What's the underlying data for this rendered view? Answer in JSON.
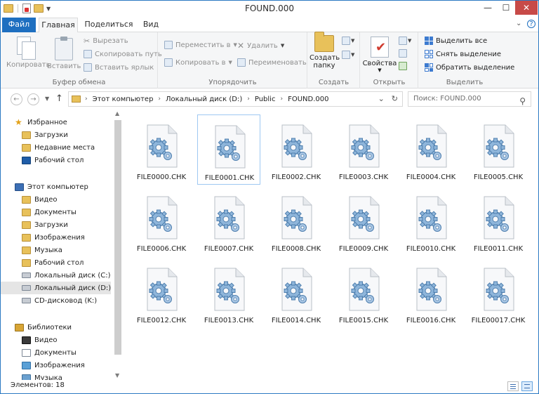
{
  "window": {
    "title": "FOUND.000",
    "controls": {
      "minimize": "—",
      "maximize": "☐",
      "close": "✕"
    }
  },
  "ribbon_tabs": {
    "file": "Файл",
    "home": "Главная",
    "share": "Поделиться",
    "view": "Вид",
    "expand": "⌄",
    "help": "?"
  },
  "ribbon": {
    "clipboard": {
      "label": "Буфер обмена",
      "copy": "Копировать",
      "paste": "Вставить",
      "cut": "Вырезать",
      "copy_path": "Скопировать путь",
      "paste_shortcut": "Вставить ярлык"
    },
    "organize": {
      "label": "Упорядочить",
      "move_to": "Переместить в",
      "copy_to": "Копировать в",
      "delete": "Удалить",
      "rename": "Переименовать"
    },
    "new": {
      "label": "Создать",
      "new_folder_line1": "Создать",
      "new_folder_line2": "папку"
    },
    "open": {
      "label": "Открыть",
      "properties": "Свойства"
    },
    "select": {
      "label": "Выделить",
      "select_all": "Выделить все",
      "select_none": "Снять выделение",
      "invert": "Обратить выделение"
    }
  },
  "address": {
    "crumbs": [
      "Этот компьютер",
      "Локальный диск (D:)",
      "Public",
      "FOUND.000"
    ],
    "search_placeholder": "Поиск: FOUND.000"
  },
  "nav": {
    "favorites": "Избранное",
    "downloads": "Загрузки",
    "recent": "Недавние места",
    "desktop": "Рабочий стол",
    "this_pc": "Этот компьютер",
    "pc_video": "Видео",
    "pc_documents": "Документы",
    "pc_downloads": "Загрузки",
    "pc_pictures": "Изображения",
    "pc_music": "Музыка",
    "pc_desktop": "Рабочий стол",
    "disk_c": "Локальный диск (C:)",
    "disk_d": "Локальный диск (D:)",
    "cd": "CD-дисковод (K:)",
    "libraries": "Библиотеки",
    "lib_video": "Видео",
    "lib_documents": "Документы",
    "lib_pictures": "Изображения",
    "lib_music": "Музыка"
  },
  "files": [
    "FILE0000.CHK",
    "FILE0001.CHK",
    "FILE0002.CHK",
    "FILE0003.CHK",
    "FILE0004.CHK",
    "FILE0005.CHK",
    "FILE0006.CHK",
    "FILE0007.CHK",
    "FILE0008.CHK",
    "FILE0009.CHK",
    "FILE0010.CHK",
    "FILE0011.CHK",
    "FILE0012.CHK",
    "FILE0013.CHK",
    "FILE0014.CHK",
    "FILE0015.CHK",
    "FILE0016.CHK",
    "FILE00017.CHK"
  ],
  "selected_file": "FILE0001.CHK",
  "status": {
    "item_count": "Элементов: 18"
  }
}
